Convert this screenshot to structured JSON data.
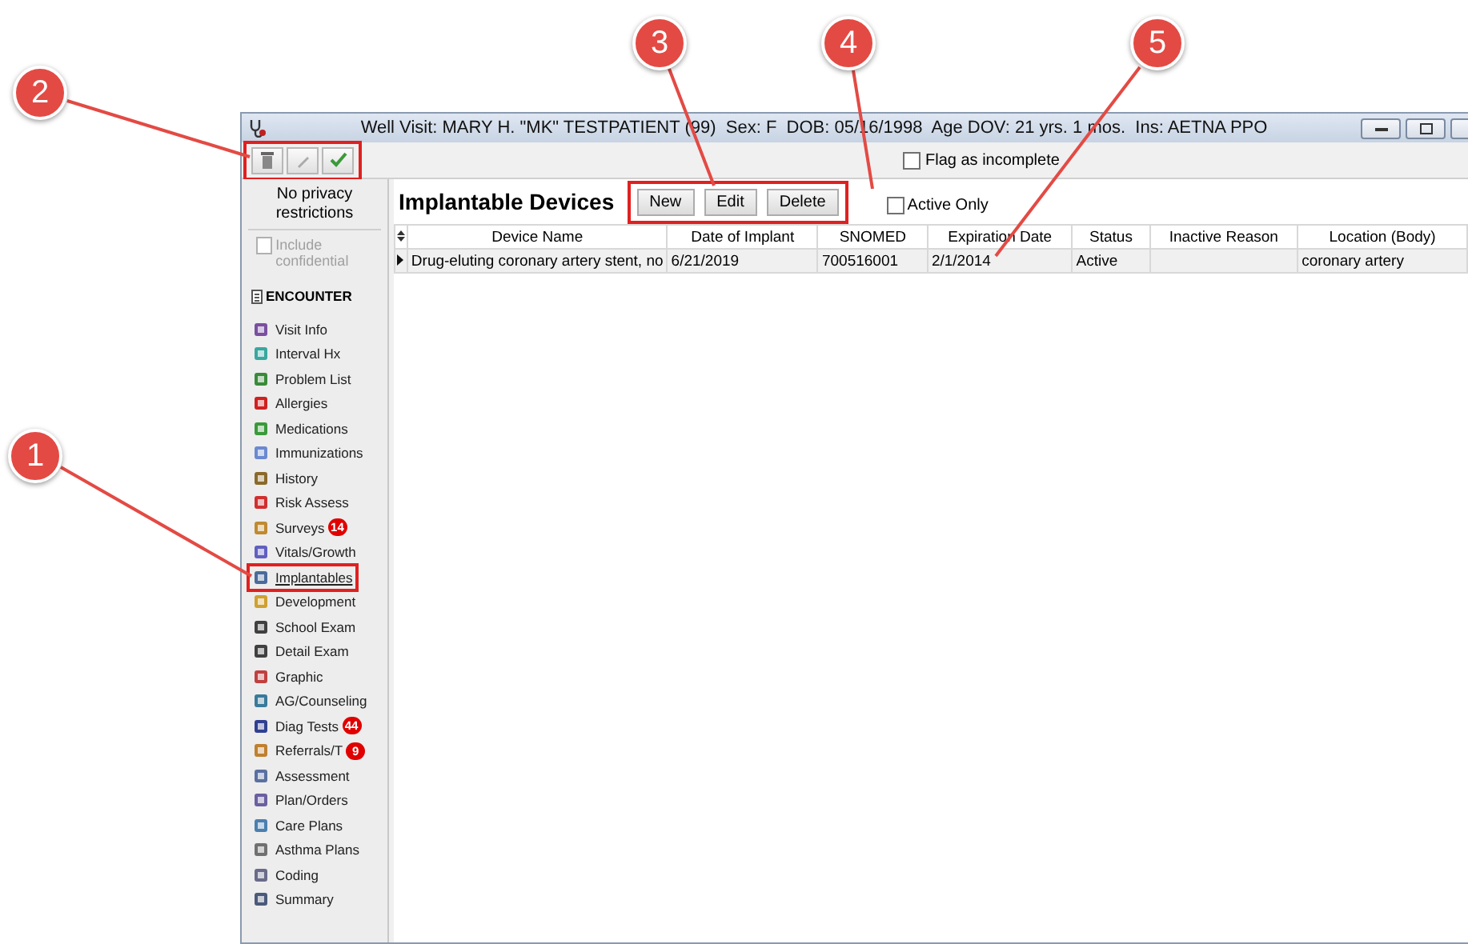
{
  "callouts": [
    {
      "label": "1"
    },
    {
      "label": "2"
    },
    {
      "label": "3"
    },
    {
      "label": "4"
    },
    {
      "label": "5"
    }
  ],
  "window": {
    "title": "Well Visit: MARY H. \"MK\" TESTPATIENT (99)  Sex: F  DOB: 05/16/1998  Age DOV: 21 yrs. 1 mos.  Ins: AETNA PPO"
  },
  "toolbar": {
    "highlighted": true,
    "flag": {
      "label": "Flag as incomplete",
      "checked": false
    }
  },
  "sidebar": {
    "privacy": "No privacy restrictions",
    "include_confidential": {
      "label": "Include confidential",
      "checked": false,
      "disabled": true
    },
    "section": "ENCOUNTER",
    "items": [
      {
        "label": "Visit Info",
        "selected": false
      },
      {
        "label": "Interval Hx",
        "selected": false
      },
      {
        "label": "Problem List",
        "selected": false
      },
      {
        "label": "Allergies",
        "selected": false
      },
      {
        "label": "Medications",
        "selected": false
      },
      {
        "label": "Immunizations",
        "selected": false
      },
      {
        "label": "History",
        "selected": false
      },
      {
        "label": "Risk Assess",
        "selected": false
      },
      {
        "label": "Surveys",
        "selected": false,
        "badge": "14"
      },
      {
        "label": "Vitals/Growth",
        "selected": false
      },
      {
        "label": "Implantables",
        "selected": true
      },
      {
        "label": "Development",
        "selected": false
      },
      {
        "label": "School Exam",
        "selected": false
      },
      {
        "label": "Detail Exam",
        "selected": false
      },
      {
        "label": "Graphic",
        "selected": false
      },
      {
        "label": "AG/Counseling",
        "selected": false
      },
      {
        "label": "Diag Tests",
        "selected": false,
        "badge": "44"
      },
      {
        "label": "Referrals/T",
        "selected": false,
        "badge": "9"
      },
      {
        "label": "Assessment",
        "selected": false
      },
      {
        "label": "Plan/Orders",
        "selected": false
      },
      {
        "label": "Care Plans",
        "selected": false
      },
      {
        "label": "Asthma Plans",
        "selected": false
      },
      {
        "label": "Coding",
        "selected": false
      },
      {
        "label": "Summary",
        "selected": false
      }
    ]
  },
  "main": {
    "title": "Implantable Devices",
    "buttons_highlighted": true,
    "buttons": [
      "New",
      "Edit",
      "Delete"
    ],
    "active_only": {
      "label": "Active Only",
      "checked": false
    },
    "table": {
      "columns": [
        "Device Name",
        "Date of Implant",
        "SNOMED",
        "Expiration Date",
        "Status",
        "Inactive Reason",
        "Location (Body)"
      ],
      "rows": [
        {
          "selected": true,
          "cells": [
            "Drug-eluting coronary artery stent, no",
            "6/21/2019",
            "700516001",
            "2/1/2014",
            "Active",
            "",
            "coronary artery"
          ]
        }
      ]
    }
  }
}
